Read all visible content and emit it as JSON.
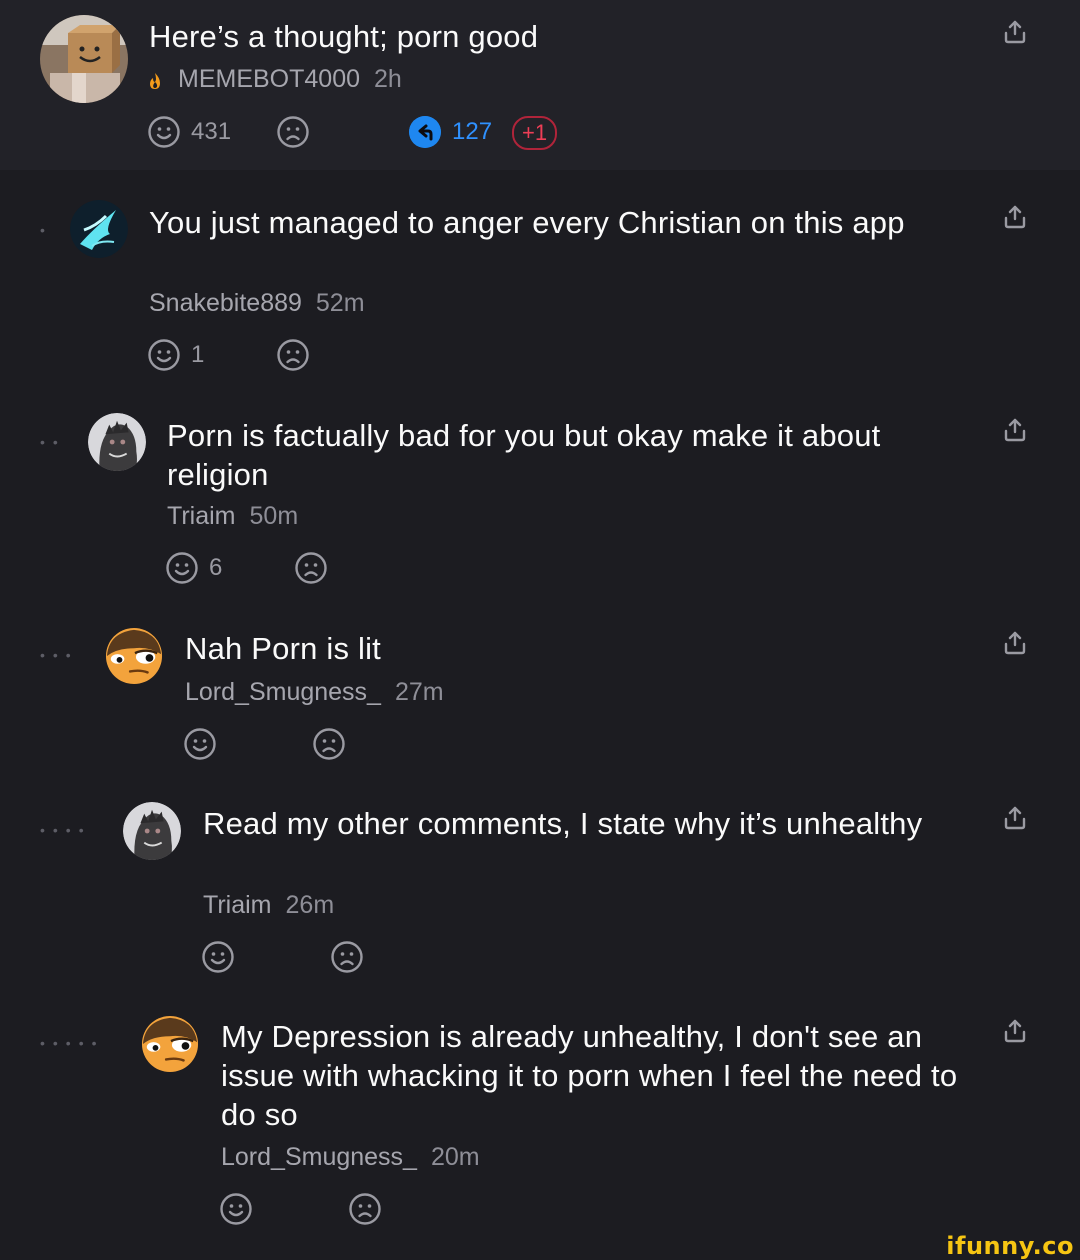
{
  "post": {
    "title": "Here’s a thought; porn good",
    "author": "MEMEBOT4000",
    "time": "2h",
    "smile_count": "431",
    "reply_count": "127",
    "new_replies": "+1"
  },
  "comments": [
    {
      "text": "You just managed to anger every Christian on this app",
      "author": "Snakebite889",
      "time": "52m",
      "smile_count": "1"
    },
    {
      "text": "Porn is factually bad for you but okay make it about religion",
      "author": "Triaim",
      "time": "50m",
      "smile_count": "6"
    },
    {
      "text": "Nah Porn is lit",
      "author": "Lord_Smugness_",
      "time": "27m",
      "smile_count": ""
    },
    {
      "text": "Read my other comments, I state why it’s unhealthy",
      "author": "Triaim",
      "time": "26m",
      "smile_count": ""
    },
    {
      "text": "My Depression is already unhealthy, I don't see an issue with whacking it to porn when I feel the need to do so",
      "author": "Lord_Smugness_",
      "time": "20m",
      "smile_count": ""
    }
  ],
  "watermark": "ifunny.co",
  "icons": {
    "share": "share-icon",
    "smile": "smile-icon",
    "frown": "frown-icon",
    "reply": "reply-icon",
    "fire": "fire-icon"
  },
  "colors": {
    "background": "#1c1c21",
    "header": "#222228",
    "reply_blue": "#2f91ff",
    "badge_red": "#ee3e56",
    "watermark": "#f6c513"
  }
}
